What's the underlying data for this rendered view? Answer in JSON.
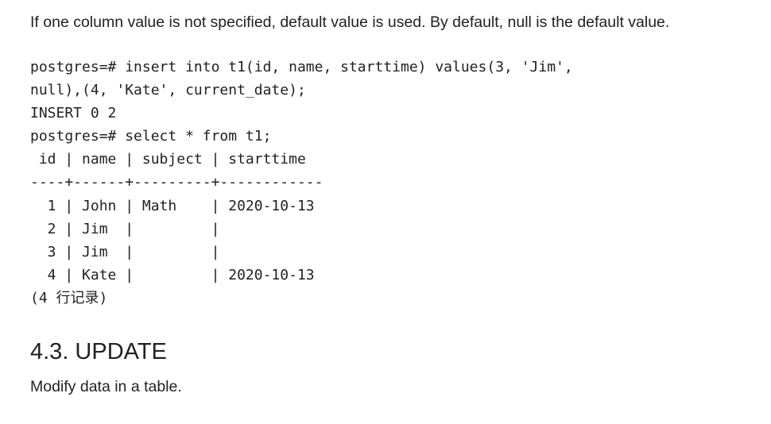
{
  "intro_text": "If one column value is not specified, default value is used. By default, null is the default value.",
  "code_block": {
    "lines": [
      "postgres=# insert into t1(id, name, starttime) values(3, 'Jim',",
      "null),(4, 'Kate', current_date);",
      "INSERT 0 2",
      "postgres=# select * from t1;",
      " id | name | subject | starttime",
      "----+------+---------+------------",
      "  1 | John | Math    | 2020-10-13",
      "  2 | Jim  |         |",
      "  3 | Jim  |         |",
      "  4 | Kate |         | 2020-10-13",
      "(4 行记录)"
    ]
  },
  "section": {
    "heading": "4.3. UPDATE",
    "description": "Modify data in a table."
  }
}
